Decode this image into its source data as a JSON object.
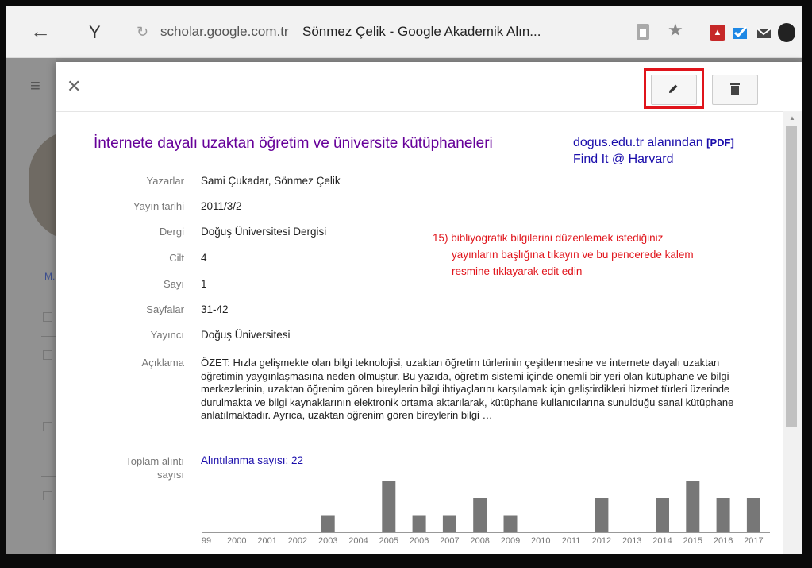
{
  "browser": {
    "back_icon": "←",
    "y_icon": "Y",
    "reload_icon": "↻",
    "url": "scholar.google.com.tr",
    "page_title": "Sönmez Çelik - Google Akademik Alın...",
    "star_icon": "★"
  },
  "dialog": {
    "close_icon": "✕",
    "title": "İnternete dayalı uzaktan öğretim ve üniversite kütüphaneleri",
    "source_text": "dogus.edu.tr alanından",
    "source_pdf": "[PDF]",
    "find_it": "Find It @ Harvard",
    "fields": [
      {
        "label": "Yazarlar",
        "value": "Sami Çukadar, Sönmez Çelik"
      },
      {
        "label": "Yayın tarihi",
        "value": "2011/3/2"
      },
      {
        "label": "Dergi",
        "value": "Doğuş Üniversitesi Dergisi"
      },
      {
        "label": "Cilt",
        "value": "4"
      },
      {
        "label": "Sayı",
        "value": "1"
      },
      {
        "label": "Sayfalar",
        "value": "31-42"
      },
      {
        "label": "Yayıncı",
        "value": "Doğuş Üniversitesi"
      }
    ],
    "description_label": "Açıklama",
    "description": "ÖZET: Hızla gelişmekte olan bilgi teknolojisi, uzaktan öğretim türlerinin çeşitlenmesine ve internete dayalı uzaktan öğretimin yaygınlaşmasına neden olmuştur. Bu yazıda, öğretim sistemi içinde önemli bir yeri olan kütüphane ve bilgi merkezlerinin, uzaktan öğrenim gören bireylerin bilgi ihtiyaçlarını karşılamak için geliştirdikleri hizmet türleri üzerinde durulmakta ve bilgi kaynaklarının elektronik ortama aktarılarak, kütüphane kullanıcılarına sunulduğu sanal kütüphane anlatılmaktadır. Ayrıca, uzaktan öğrenim gören bireylerin bilgi …",
    "citations_label_1": "Toplam alıntı",
    "citations_label_2": "sayısı",
    "citations_link": "Alıntılanma sayısı: 22"
  },
  "annotation": {
    "line1": "15) bibliyografik bilgilerini düzenlemek istediğiniz",
    "line2": "yayınların başlığına tıkayın ve bu pencerede kalem",
    "line3": "resmine tıklayarak edit edin",
    "color": "#e0141b"
  },
  "colors": {
    "bar": "#777777",
    "highlight": "#e0141b",
    "title_link": "#660099",
    "link": "#1a0dab"
  },
  "chart_data": {
    "type": "bar",
    "categories": [
      "99",
      "2000",
      "2001",
      "2002",
      "2003",
      "2004",
      "2005",
      "2006",
      "2007",
      "2008",
      "2009",
      "2010",
      "2011",
      "2012",
      "2013",
      "2014",
      "2015",
      "2016",
      "2017"
    ],
    "values": [
      0,
      0,
      0,
      0,
      1,
      0,
      3,
      1,
      1,
      2,
      1,
      0,
      0,
      2,
      0,
      2,
      3,
      2,
      2
    ],
    "ylim": [
      0,
      3
    ]
  }
}
